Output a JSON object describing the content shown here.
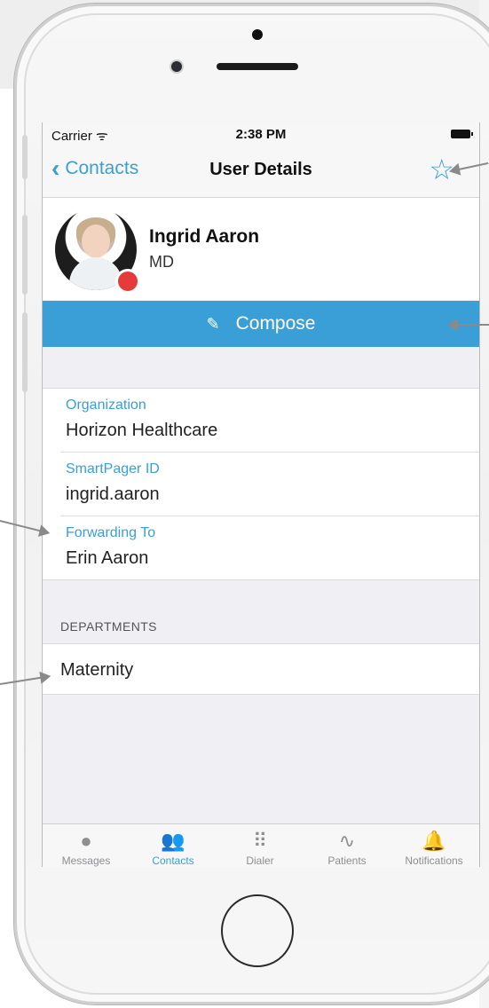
{
  "status_bar": {
    "carrier": "Carrier ᯤ",
    "time": "2:38 PM"
  },
  "nav": {
    "back_label": "Contacts",
    "title": "User Details",
    "favorite_icon": "star-outline-icon"
  },
  "profile": {
    "name": "Ingrid Aaron",
    "title": "MD",
    "presence_color": "#e53b3b"
  },
  "compose": {
    "label": "Compose",
    "icon": "compose-icon",
    "color": "#3b9fd7"
  },
  "fields": [
    {
      "label": "Organization",
      "value": "Horizon Healthcare"
    },
    {
      "label": "SmartPager ID",
      "value": "ingrid.aaron"
    },
    {
      "label": "Forwarding To",
      "value": "Erin Aaron"
    }
  ],
  "departments": {
    "header": "DEPARTMENTS",
    "items": [
      "Maternity"
    ]
  },
  "tabbar": {
    "tabs": [
      {
        "label": "Messages",
        "icon": "chat-bubble-icon",
        "active": false
      },
      {
        "label": "Contacts",
        "icon": "people-icon",
        "active": true
      },
      {
        "label": "Dialer",
        "icon": "keypad-icon",
        "active": false
      },
      {
        "label": "Patients",
        "icon": "heartbeat-icon",
        "active": false
      },
      {
        "label": "Notifications",
        "icon": "bell-icon",
        "active": false
      }
    ]
  },
  "accent_color": "#3a9fd6"
}
